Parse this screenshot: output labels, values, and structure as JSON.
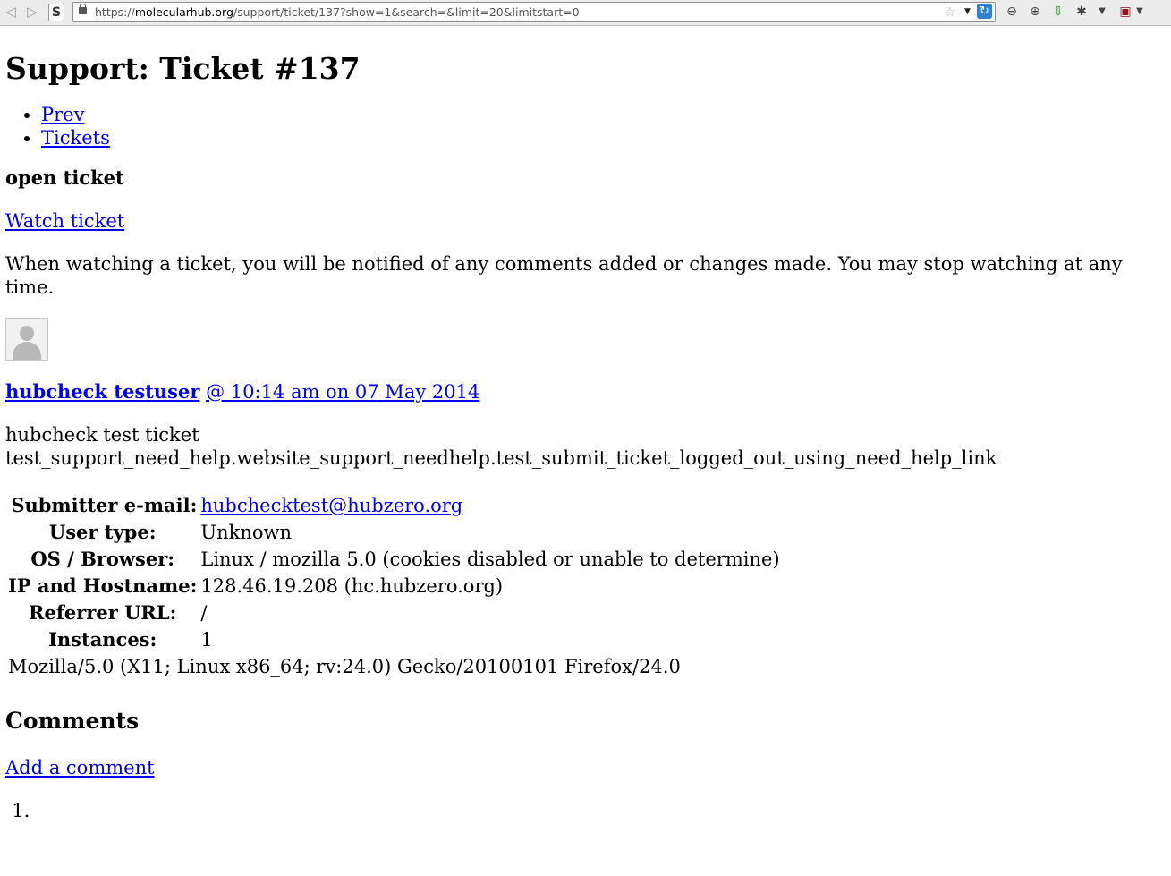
{
  "browser": {
    "url_prefix": "https://",
    "url_domain": "molecularhub.org",
    "url_path": "/support/ticket/137?show=1&search=&limit=20&limitstart=0",
    "s_label": "S"
  },
  "page": {
    "title": "Support: Ticket #137",
    "nav": [
      "Prev",
      "Tickets"
    ],
    "status": "open ticket",
    "watch_link": "Watch ticket",
    "watch_note": "When watching a ticket, you will be notified of any comments added or changes made. You may stop watching at any time.",
    "author": "hubcheck testuser",
    "timestamp": "@ 10:14 am on 07 May 2014",
    "report_line1": "hubcheck test ticket",
    "report_line2": "test_support_need_help.website_support_needhelp.test_submit_ticket_logged_out_using_need_help_link",
    "details": {
      "email_label": "Submitter e-mail:",
      "email_value": "hubchecktest@hubzero.org",
      "user_type_label": "User type:",
      "user_type_value": "Unknown",
      "os_label": "OS / Browser:",
      "os_value": "Linux / mozilla 5.0 (cookies disabled or unable to determine)",
      "ip_label": "IP and Hostname:",
      "ip_value": "128.46.19.208 (hc.hubzero.org)",
      "referrer_label": "Referrer URL:",
      "referrer_value": "/",
      "instances_label": "Instances:",
      "instances_value": "1",
      "user_agent": "Mozilla/5.0 (X11; Linux x86_64; rv:24.0) Gecko/20100101 Firefox/24.0"
    },
    "comments_heading": "Comments",
    "add_comment_link": "Add a comment"
  }
}
